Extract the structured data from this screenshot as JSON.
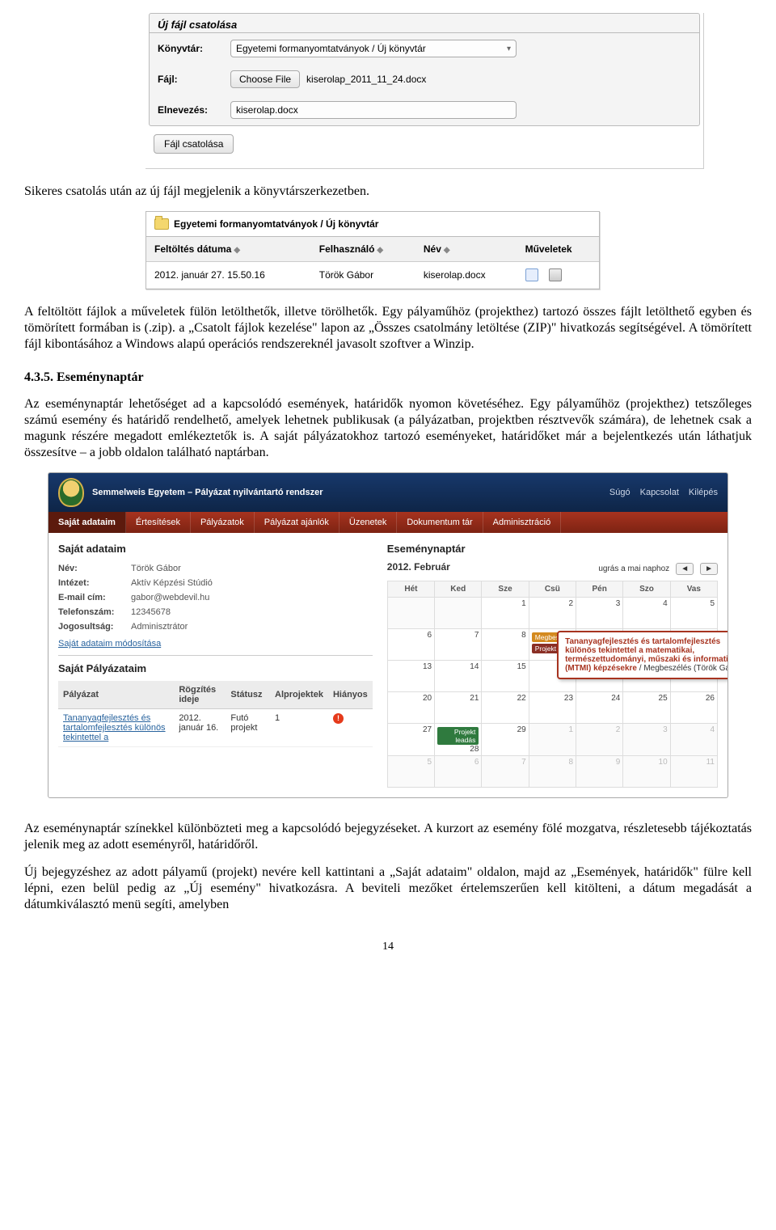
{
  "shot1": {
    "panel_title": "Új fájl csatolása",
    "labels": {
      "dir": "Könyvtár:",
      "file": "Fájl:",
      "name": "Elnevezés:"
    },
    "dir_value": "Egyetemi formanyomtatványok / Új könyvtár",
    "choose_btn": "Choose File",
    "chosen_file": "kiserolap_2011_11_24.docx",
    "name_value": "kiserolap.docx",
    "attach_btn": "Fájl csatolása"
  },
  "para1": "Sikeres csatolás után az új fájl megjelenik a könyvtárszerkezetben.",
  "shot2": {
    "crumb": "Egyetemi formanyomtatványok / Új könyvtár",
    "headers": [
      "Feltöltés dátuma",
      "Felhasználó",
      "Név",
      "Műveletek"
    ],
    "row": {
      "date": "2012. január 27. 15.50.16",
      "user": "Török Gábor",
      "name": "kiserolap.docx"
    }
  },
  "para2": "A feltöltött fájlok a műveletek fülön letölthetők, illetve törölhetők. Egy pályaműhöz (projekthez) tartozó összes fájlt letölthető egyben és tömörített formában is (.zip). a „Csatolt fájlok kezelése\" lapon az „Összes csatolmány letöltése (ZIP)\" hivatkozás segítségével. A tömörített fájl kibontásához a Windows alapú operációs rendszereknél javasolt szoftver a Winzip.",
  "sec_title": "4.3.5. Eseménynaptár",
  "para3": "Az eseménynaptár lehetőséget ad a kapcsolódó események, határidők nyomon követéséhez. Egy pályaműhöz (projekthez) tetszőleges számú esemény és határidő rendelhető, amelyek lehetnek publikusak (a pályázatban, projektben résztvevők számára), de lehetnek csak a magunk részére megadott emlékeztetők is. A saját pályázatokhoz tartozó eseményeket, határidőket már a bejelentkezés után láthatjuk összesítve – a jobb oldalon található naptárban.",
  "shot3": {
    "app_title": "Semmelweis Egyetem – Pályázat nyilvántartó rendszer",
    "toplinks": [
      "Súgó",
      "Kapcsolat",
      "Kilépés"
    ],
    "nav": [
      "Saját adataim",
      "Értesítések",
      "Pályázatok",
      "Pályázat ajánlók",
      "Üzenetek",
      "Dokumentum tár",
      "Adminisztráció"
    ],
    "left": {
      "title": "Saját adataim",
      "fields": {
        "nev_k": "Név:",
        "nev_v": "Török Gábor",
        "int_k": "Intézet:",
        "int_v": "Aktív Képzési Stúdió",
        "ema_k": "E-mail cím:",
        "ema_v": "gabor@webdevil.hu",
        "tel_k": "Telefonszám:",
        "tel_v": "12345678",
        "jog_k": "Jogosultság:",
        "jog_v": "Adminisztrátor"
      },
      "edit_link": "Saját adataim módosítása",
      "sec2": "Saját Pályázataim",
      "headers": [
        "Pályázat",
        "Rögzítés ideje",
        "Státusz",
        "Alprojektek",
        "Hiányos"
      ],
      "row": {
        "name": "Tananyagfejlesztés és tartalomfejlesztés különös tekintettel a",
        "date": "2012. január 16.",
        "status": "Futó projekt",
        "sub": "1"
      }
    },
    "right": {
      "title": "Eseménynaptár",
      "month": "2012. Február",
      "jump": "ugrás a mai naphoz",
      "prev": "◄",
      "next": "►",
      "dows": [
        "Hét",
        "Ked",
        "Sze",
        "Csü",
        "Pén",
        "Szo",
        "Vas"
      ],
      "tags": {
        "meet": "Megbesz",
        "proj": "Projekt",
        "dead": "Projekt leadás"
      },
      "tooltip": "Tananyagfejlesztés és tartalomfejlesztés különös tekintettel a matematikai, természettudományi, műszaki és informatikai (MTMI) képzésekre / Megbeszélés (Török Gábor)"
    }
  },
  "para4": "Az eseménynaptár színekkel különbözteti meg a kapcsolódó bejegyzéseket. A kurzort az esemény fölé mozgatva, részletesebb tájékoztatás jelenik meg az adott eseményről, határidőről.",
  "para5": "Új bejegyzéshez az adott pályamű (projekt) nevére kell kattintani a „Saját adataim\" oldalon, majd az „Események, határidők\" fülre kell lépni, ezen belül pedig az „Új esemény\" hivatkozásra. A beviteli mezőket értelemszerűen kell kitölteni, a dátum megadását a dátumkiválasztó menü segíti, amelyben",
  "page_num": "14"
}
